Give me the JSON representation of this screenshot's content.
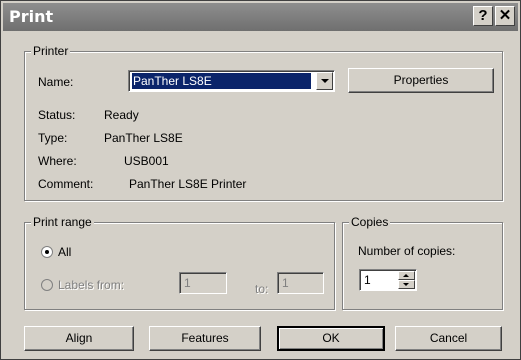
{
  "window": {
    "title": "Print",
    "help_label": "?",
    "close_label": "✕"
  },
  "printer": {
    "legend": "Printer",
    "name_label": "Name:",
    "name_value": "PanTher LS8E",
    "properties_label": "Properties",
    "status_label": "Status:",
    "status_value": "Ready",
    "type_label": "Type:",
    "type_value": "PanTher LS8E",
    "where_label": "Where:",
    "where_value": "USB001",
    "comment_label": "Comment:",
    "comment_value": "PanTher LS8E Printer"
  },
  "print_range": {
    "legend": "Print range",
    "all_label": "All",
    "labels_from_label": "Labels from:",
    "from_value": "1",
    "to_label": "to:",
    "to_value": "1"
  },
  "copies": {
    "legend": "Copies",
    "number_label": "Number of copies:",
    "value": "1"
  },
  "buttons": {
    "align": "Align",
    "features": "Features",
    "ok": "OK",
    "cancel": "Cancel"
  }
}
